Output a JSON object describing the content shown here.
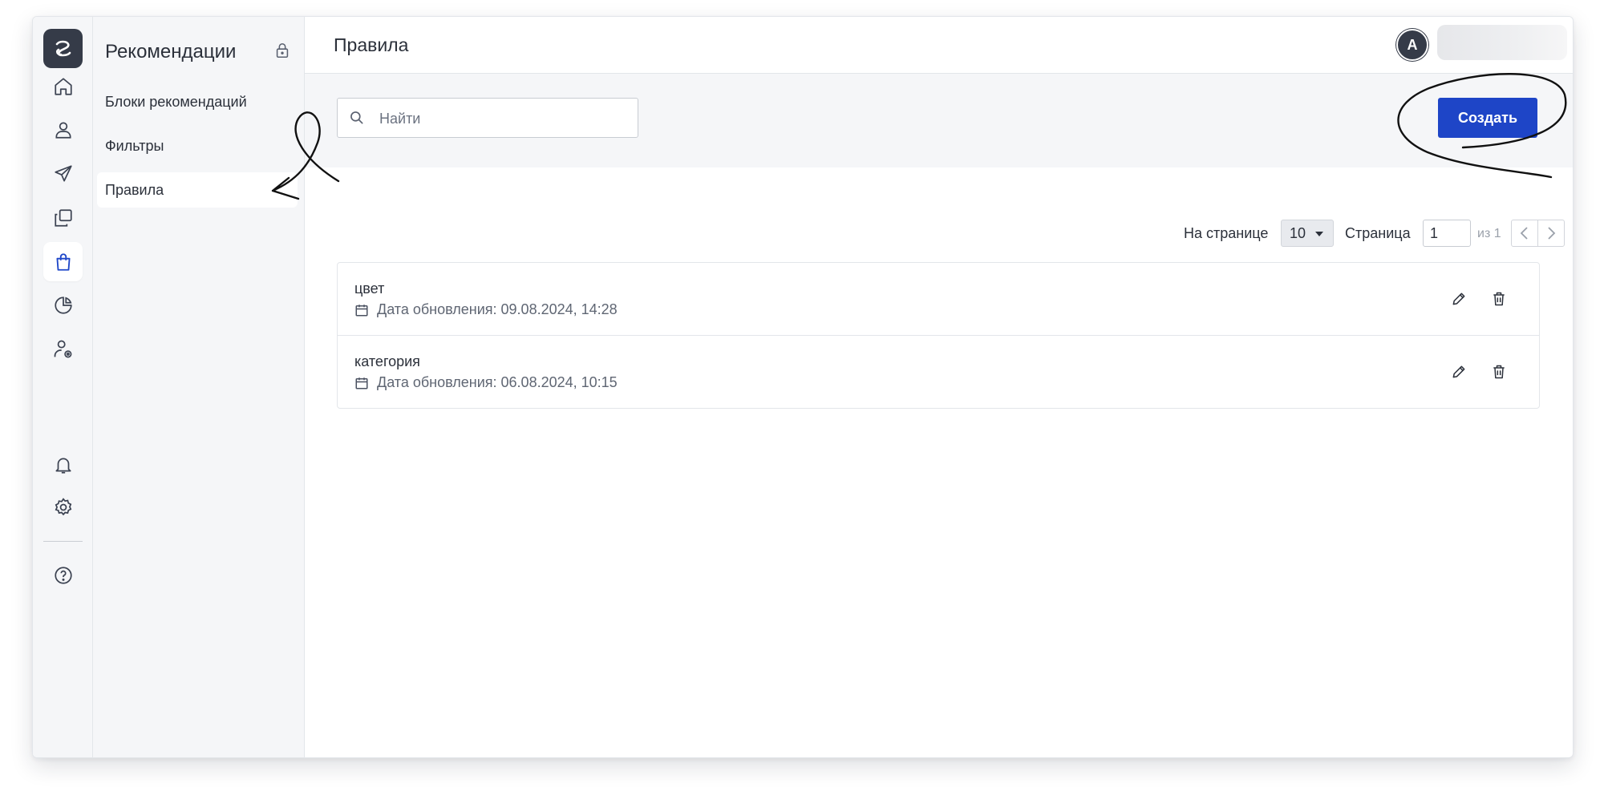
{
  "subnav": {
    "title": "Рекомендации",
    "items": [
      {
        "label": "Блоки рекомендаций"
      },
      {
        "label": "Фильтры"
      },
      {
        "label": "Правила"
      }
    ]
  },
  "header": {
    "page_title": "Правила",
    "avatar_letter": "A"
  },
  "toolbar": {
    "search_placeholder": "Найти",
    "create_label": "Создать"
  },
  "pager": {
    "per_page_label": "На странице",
    "per_page_value": "10",
    "page_label": "Страница",
    "page_value": "1",
    "of_label": "из 1"
  },
  "rules": [
    {
      "name": "цвет",
      "updated": "Дата обновления: 09.08.2024, 14:28"
    },
    {
      "name": "категория",
      "updated": "Дата обновления: 06.08.2024, 10:15"
    }
  ],
  "colors": {
    "accent": "#1e45c7",
    "rail_bg": "#f5f6f8",
    "logo_bg": "#353b48"
  },
  "icons": [
    "logo-icon",
    "home-icon",
    "user-icon",
    "send-icon",
    "copy-icon",
    "shopping-bag-icon",
    "pie-chart-icon",
    "user-settings-icon",
    "bell-icon",
    "gear-icon",
    "help-icon",
    "lock-icon",
    "search-icon",
    "calendar-icon",
    "pencil-icon",
    "trash-icon",
    "chevron-left-icon",
    "chevron-right-icon"
  ]
}
